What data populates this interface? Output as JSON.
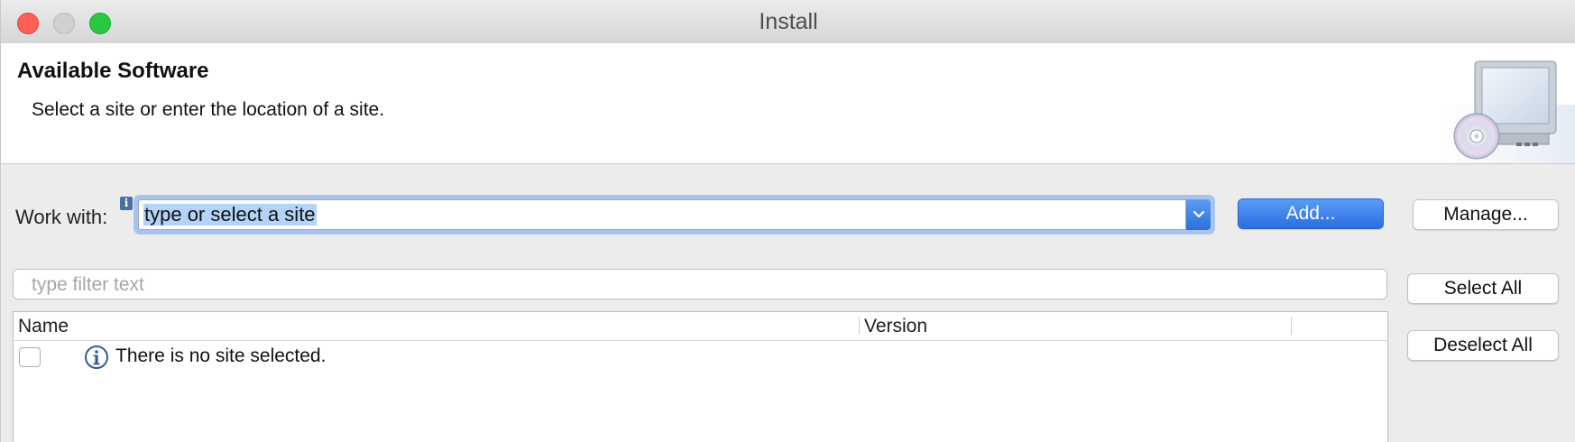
{
  "window": {
    "title": "Install"
  },
  "header": {
    "title": "Available Software",
    "description": "Select a site or enter the location of a site."
  },
  "work_with": {
    "label": "Work with:",
    "value": "type or select a site",
    "add_label": "Add...",
    "manage_label": "Manage..."
  },
  "filter": {
    "placeholder": "type filter text"
  },
  "table": {
    "columns": [
      "Name",
      "Version"
    ],
    "rows": [
      {
        "checked": false,
        "icon": "info-icon",
        "name": "There is no site selected.",
        "version": ""
      }
    ]
  },
  "actions": {
    "select_all_label": "Select All",
    "deselect_all_label": "Deselect All"
  },
  "colors": {
    "accent": "#2a6ee0",
    "close": "#fe5f57",
    "zoom": "#28c840",
    "selection": "#b3d3f8"
  },
  "icons": [
    "install-cd-monitor-icon",
    "info-badge-icon",
    "chevron-down-icon",
    "info-icon"
  ]
}
